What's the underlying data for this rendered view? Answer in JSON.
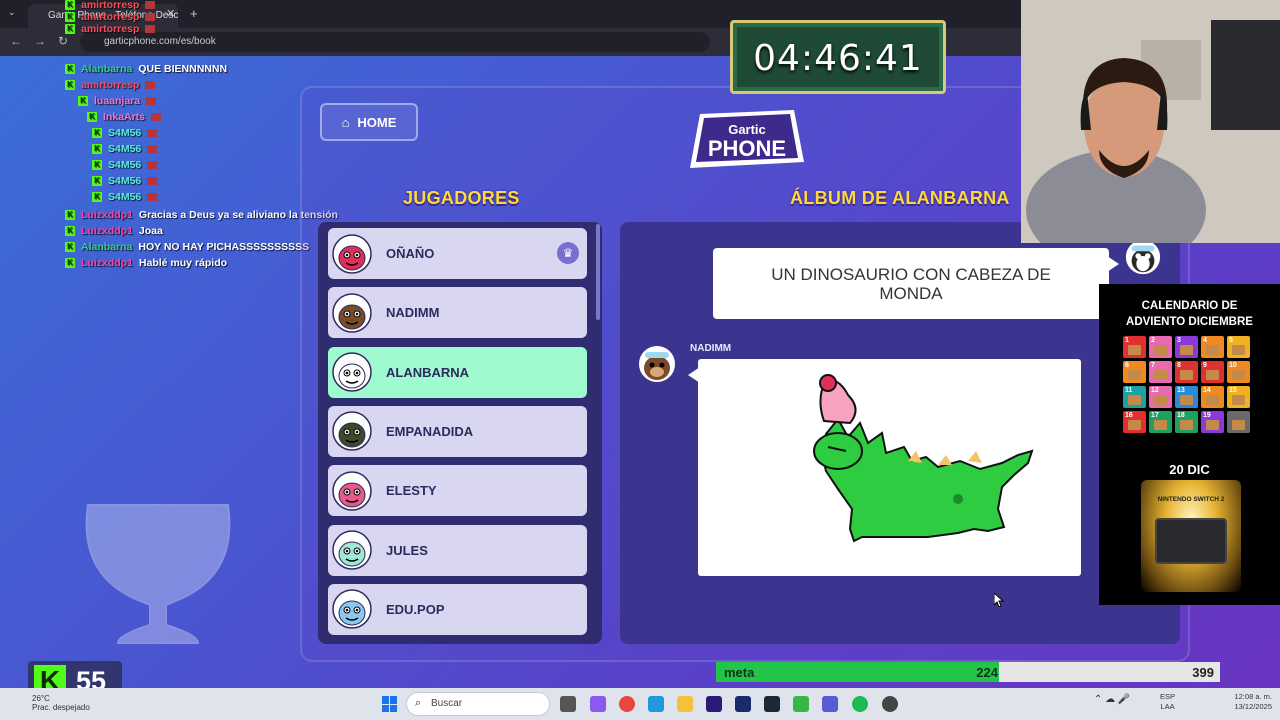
{
  "browser": {
    "tab_title": "Gartic Phone - Teléfono Desc...",
    "url": "garticphone.com/es/book"
  },
  "chat": [
    {
      "user": "amirtorresp",
      "user_color": "#ff4a5a",
      "message": ""
    },
    {
      "user": "amirtorresp",
      "user_color": "#ff4a5a",
      "message": ""
    },
    {
      "user": "amirtorresp",
      "user_color": "#ff4a5a",
      "message": ""
    },
    {
      "user": "Alanbarna",
      "user_color": "#2ed38a",
      "message": "QUE BIENNNNNN"
    },
    {
      "user": "amirtorresp",
      "user_color": "#ff4a5a",
      "message": ""
    },
    {
      "user": "luaanjara",
      "user_color": "#ff6fd1",
      "message": ""
    },
    {
      "user": "InkaArts",
      "user_color": "#ff6fd1",
      "message": ""
    },
    {
      "user": "S4M56",
      "user_color": "#53f0d8",
      "message": ""
    },
    {
      "user": "S4M56",
      "user_color": "#53f0d8",
      "message": ""
    },
    {
      "user": "S4M56",
      "user_color": "#53f0d8",
      "message": ""
    },
    {
      "user": "S4M56",
      "user_color": "#53f0d8",
      "message": ""
    },
    {
      "user": "S4M56",
      "user_color": "#53f0d8",
      "message": ""
    },
    {
      "user": "Luizxddp1",
      "user_color": "#ff3fa6",
      "message": "Gracias a Deus ya se aliviano la tensión"
    },
    {
      "user": "Luizxddp1",
      "user_color": "#ff3fa6",
      "message": "Joaa"
    },
    {
      "user": "Alanbarna",
      "user_color": "#2ed38a",
      "message": "HOY NO HAY PICHASSSSSSSSSS"
    },
    {
      "user": "Luizxddp1",
      "user_color": "#ff3fa6",
      "message": "Hablé muy rápido"
    }
  ],
  "game": {
    "home_label": "HOME",
    "logo_top": "Gartic",
    "logo_bottom": "PHONE",
    "players_title": "JUGADORES",
    "album_title": "ÁLBUM DE ALANBARNA",
    "players": [
      {
        "name": "OÑAÑO",
        "host": true,
        "active": false,
        "avatar_color": "#e0305a"
      },
      {
        "name": "NADIMM",
        "host": false,
        "active": false,
        "avatar_color": "#7a4a2a"
      },
      {
        "name": "ALANBARNA",
        "host": false,
        "active": true,
        "avatar_color": "#ffffff"
      },
      {
        "name": "EMPANADIDA",
        "host": false,
        "active": false,
        "avatar_color": "#3a4a2a"
      },
      {
        "name": "ELESTY",
        "host": false,
        "active": false,
        "avatar_color": "#e85a8a"
      },
      {
        "name": "JULES",
        "host": false,
        "active": false,
        "avatar_color": "#9fe8d8"
      },
      {
        "name": "EDU.POP",
        "host": false,
        "active": false,
        "avatar_color": "#8ac8f0"
      }
    ],
    "prompt_text": "UN DINOSAURIO CON CABEZA DE MONDA",
    "drawer_name": "NADIMM"
  },
  "timer": "04:46:41",
  "advent": {
    "title_line1": "CALENDARIO DE",
    "title_line2": "ADVIENTO DICIEMBRE",
    "days": [
      "1",
      "2",
      "3",
      "4",
      "5",
      "6",
      "7",
      "8",
      "9",
      "10",
      "11",
      "12",
      "13",
      "14",
      "15",
      "16",
      "17",
      "18",
      "19",
      ""
    ],
    "current_day": "20 DIC",
    "prize_label": "NINTENDO SWITCH 2"
  },
  "meta": {
    "label": "meta",
    "current": "224",
    "goal": "399",
    "progress": 0.561
  },
  "kick_counter": "55",
  "taskbar": {
    "weather_temp": "26°C",
    "weather_desc": "Prac. despejado",
    "search_placeholder": "Buscar",
    "lang_line1": "ESP",
    "lang_line2": "LAA",
    "time": "12:08 a. m.",
    "date": "13/12/2025"
  }
}
